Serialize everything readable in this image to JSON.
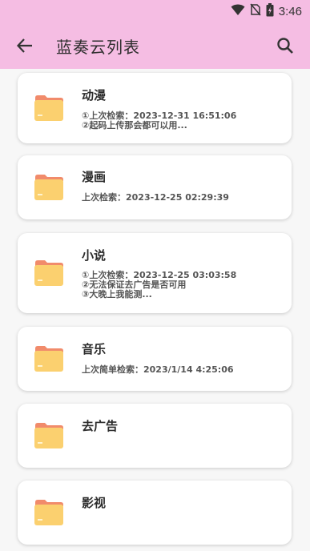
{
  "status": {
    "time": "3:46",
    "icons": [
      "wifi-icon",
      "no-sim-icon",
      "battery-charging-icon"
    ]
  },
  "appbar": {
    "title": "蓝奏云列表",
    "back_icon": "arrow-back-icon",
    "search_icon": "search-icon"
  },
  "colors": {
    "bar": "#f5bde3",
    "folder_body": "#fbd06f",
    "folder_tab": "#f18b6b",
    "card": "#ffffff"
  },
  "items": [
    {
      "name": "动漫",
      "desc": "①上次检索：2023-12-31  16:51:06\n②起码上传那会都可以用..."
    },
    {
      "name": "漫画",
      "desc": "上次检索：2023-12-25  02:29:39"
    },
    {
      "name": "小说",
      "desc": "①上次检索：2023-12-25  03:03:58\n②无法保证去广告是否可用\n③大晚上我能测..."
    },
    {
      "name": "音乐",
      "desc": "上次简单检索：2023/1/14  4:25:06"
    },
    {
      "name": "去广告",
      "desc": ""
    },
    {
      "name": "影视",
      "desc": ""
    }
  ]
}
